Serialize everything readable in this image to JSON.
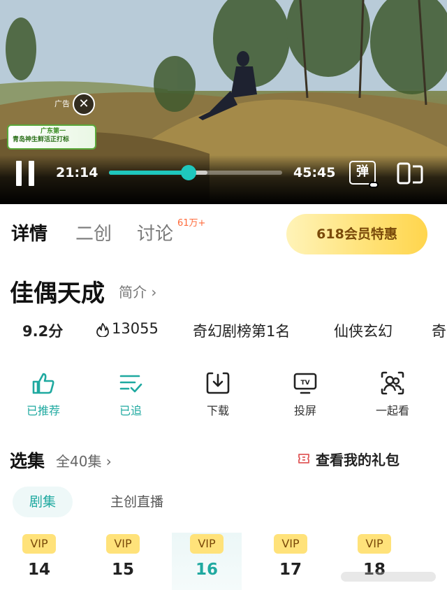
{
  "player": {
    "ad_label": "广告",
    "ad_close": "✕",
    "ad_banner": {
      "line1": "广东第一",
      "line2": "青岛神生鲜活正打标"
    },
    "current_time": "21:14",
    "total_time": "45:45",
    "progress": 0.46,
    "buffered": 0.57,
    "danmu_label": "弹"
  },
  "tabs": [
    {
      "label": "详情"
    },
    {
      "label": "二创"
    },
    {
      "label": "讨论",
      "badge": "61万+"
    }
  ],
  "promo": {
    "label": "618会员特惠"
  },
  "show": {
    "title": "佳偶天成",
    "intro_label": "简介 ›",
    "score": "9.2分",
    "heat": "13055",
    "rank": "奇幻剧榜第1名",
    "genre": "仙侠玄幻",
    "more": "奇"
  },
  "actions": [
    {
      "label": "已推荐",
      "icon": "thumb-up-icon",
      "active": true
    },
    {
      "label": "已追",
      "icon": "follow-list-icon",
      "active": true
    },
    {
      "label": "下载",
      "icon": "download-icon",
      "active": false
    },
    {
      "label": "投屏",
      "icon": "tv-cast-icon",
      "active": false
    },
    {
      "label": "一起看",
      "icon": "watch-together-icon",
      "active": false
    }
  ],
  "episodes": {
    "title": "选集",
    "count": "全40集 ›",
    "gift_label": "查看我的礼包",
    "subtabs": [
      "剧集",
      "主创直播"
    ],
    "vip_label": "VIP",
    "items": [
      "14",
      "15",
      "16",
      "17",
      "18"
    ],
    "selected": "16"
  },
  "colors": {
    "accent": "#1fc7bd",
    "accent_text": "#1fa9a0",
    "vip": "#ffe27a",
    "badge": "#ff6a3a"
  }
}
